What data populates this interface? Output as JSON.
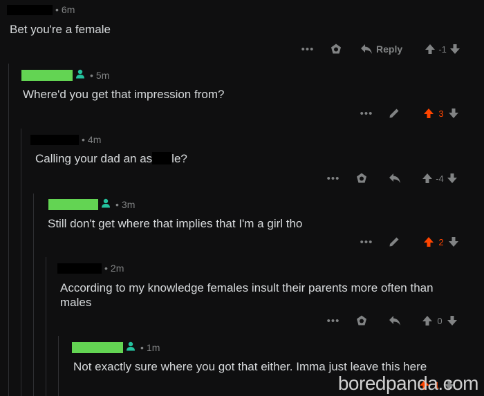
{
  "comments": [
    {
      "time": "6m",
      "text": "Bet you're a female",
      "score": "-1",
      "reply": "Reply"
    },
    {
      "time": "5m",
      "text": "Where'd you get that impression from?",
      "score": "3"
    },
    {
      "time": "4m",
      "text": "Calling your dad an as",
      "text2": "le?",
      "score": "-4"
    },
    {
      "time": "3m",
      "text": "Still don't get where that implies that I'm a girl tho",
      "score": "2"
    },
    {
      "time": "2m",
      "text": "According to my knowledge females insult their parents more often than",
      "text_line2": "males",
      "score": "0"
    },
    {
      "time": "1m",
      "text": "Not exactly sure where you got that either. Imma just leave this here",
      "score": "1"
    }
  ],
  "ui": {
    "dot": "•",
    "more": "•••"
  },
  "colors": {
    "background": "#0f0f10",
    "text": "#d7dadc",
    "meta": "#818384",
    "upvote": "#ff4500",
    "op_badge": "#63d453",
    "user_icon": "#24c29e"
  },
  "watermark": "boredpanda.com"
}
